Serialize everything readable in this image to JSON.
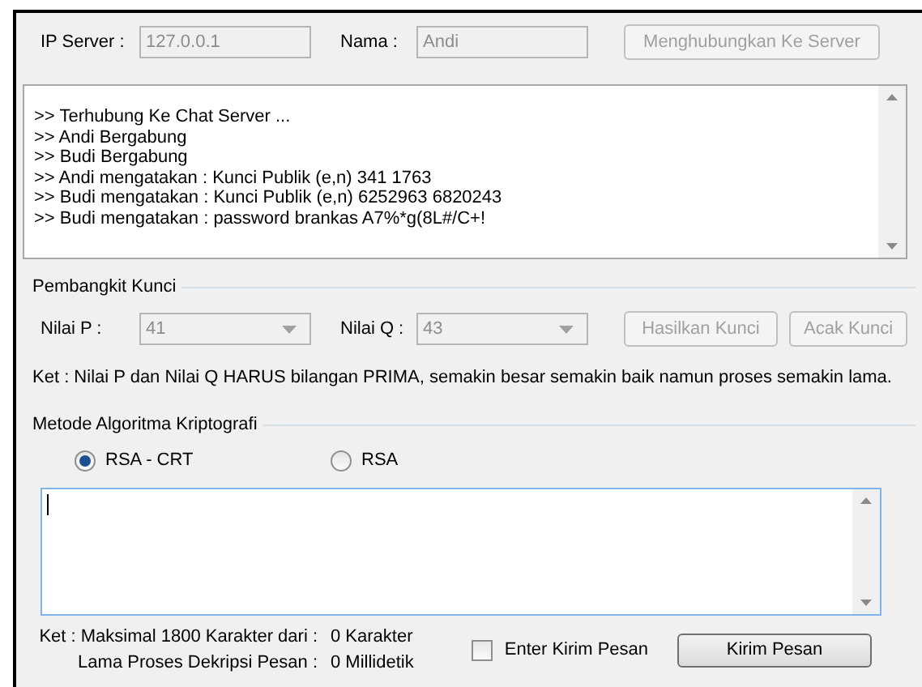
{
  "connection": {
    "ip_label": "IP Server :",
    "ip_value": "127.0.0.1",
    "ip_disabled": true,
    "name_label": "Nama :",
    "name_value": "Andi",
    "name_disabled": true,
    "connect_button": {
      "label": "Menghubungkan Ke Server",
      "disabled": true
    }
  },
  "chat_log": [
    ">> Terhubung Ke Chat Server ...",
    ">> Andi Bergabung",
    ">> Budi Bergabung",
    ">> Andi mengatakan : Kunci Publik (e,n) 341 1763",
    ">> Budi mengatakan : Kunci Publik (e,n) 6252963 6820243",
    ">> Budi mengatakan : password brankas A7%*g(8L#/C+!"
  ],
  "key_generator": {
    "title": "Pembangkit Kunci",
    "p_label": "Nilai P :",
    "p_value": "41",
    "q_label": "Nilai Q :",
    "q_value": "43",
    "combos_disabled": true,
    "buttons": [
      {
        "label": "Hasilkan Kunci",
        "disabled": true
      },
      {
        "label": "Acak Kunci",
        "disabled": true
      }
    ],
    "note": "Ket : Nilai P dan Nilai Q HARUS bilangan PRIMA, semakin besar semakin baik namun proses semakin lama."
  },
  "method": {
    "title": "Metode Algoritma Kriptografi",
    "options": [
      {
        "label": "RSA - CRT",
        "selected": true
      },
      {
        "label": "RSA",
        "selected": false
      }
    ]
  },
  "message": {
    "char_label": "Ket : Maksimal 1800 Karakter dari :",
    "char_value": "0 Karakter",
    "time_label": "Lama Proses Dekripsi Pesan :",
    "time_value": "0 Millidetik",
    "enter_send": {
      "label": "Enter Kirim Pesan",
      "checked": false
    },
    "send_button": "Kirim Pesan"
  }
}
